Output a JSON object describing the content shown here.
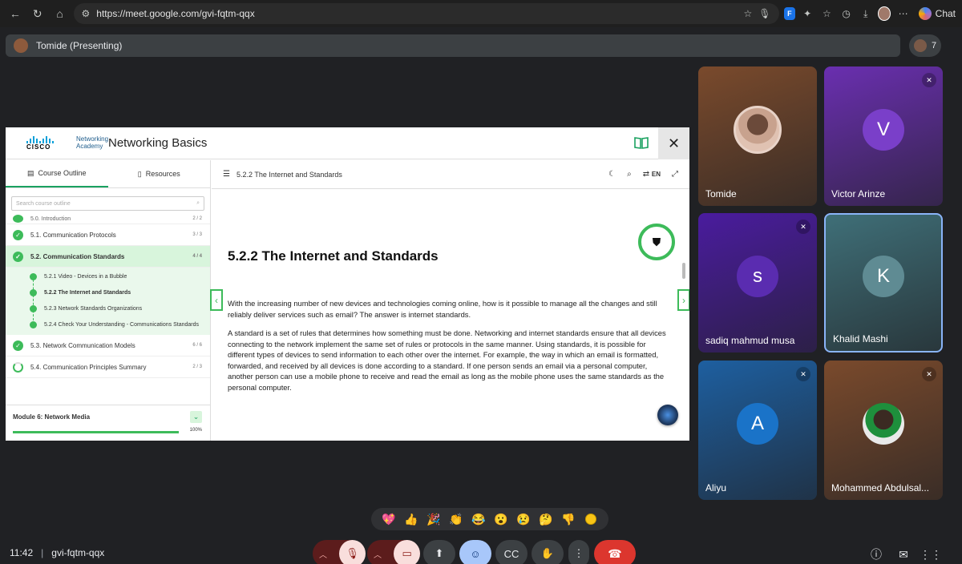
{
  "browser": {
    "url": "https://meet.google.com/gvi-fqtm-qqx",
    "chat_label": "Chat"
  },
  "presenter": {
    "label": "Tomide (Presenting)",
    "participant_count": "7"
  },
  "share": {
    "academy_label": "Networking Academy",
    "cisco_word": "CISCO",
    "course_title": "Networking Basics",
    "tabs": {
      "outline": "Course Outline",
      "resources": "Resources"
    },
    "search_placeholder": "Search course outline",
    "outline": {
      "cut_item": {
        "label": "5.0. Introduction",
        "count": "2 / 2"
      },
      "items": [
        {
          "label": "5.1. Communication Protocols",
          "count": "3 / 3"
        },
        {
          "label": "5.2. Communication Standards",
          "count": "4 / 4"
        }
      ],
      "subitems": [
        "5.2.1 Video - Devices in a Bubble",
        "5.2.2 The Internet and Standards",
        "5.2.3 Network Standards Organizations",
        "5.2.4 Check Your Understanding - Communications Standards"
      ],
      "after_items": [
        {
          "label": "5.3. Network Communication Models",
          "count": "6 / 6"
        },
        {
          "label": "5.4. Communication Principles Summary",
          "count": "2 / 3"
        }
      ]
    },
    "module": {
      "title": "Module 6: Network Media",
      "percent": "100%"
    },
    "content": {
      "breadcrumb_title": "5.2.2 The Internet and Standards",
      "lang": "EN",
      "section_title": "5.2.2 The Internet and Standards",
      "para1": "With the increasing number of new devices and technologies coming online, how is it possible to manage all the changes and still reliably deliver services such as email? The answer is internet standards.",
      "para2": "A standard is a set of rules that determines how something must be done. Networking and internet standards ensure that all devices connecting to the network implement the same set of rules or protocols in the same manner. Using standards, it is possible for different types of devices to send information to each other over the internet. For example, the way in which an email is formatted, forwarded, and received by all devices is done according to a standard. If one person sends an email via a personal computer, another person can use a mobile phone to receive and read the email as long as the mobile phone uses the same standards as the personal computer."
    }
  },
  "participants": [
    {
      "name": "Tomide",
      "initial": "",
      "bg": "#7a4a2c"
    },
    {
      "name": "Victor Arinze",
      "initial": "V",
      "bg": "#6a2fb0"
    },
    {
      "name": "sadiq mahmud musa",
      "initial": "s",
      "bg": "#4a1c9e"
    },
    {
      "name": "Khalid Mashi",
      "initial": "K",
      "bg": "#3f6f78"
    },
    {
      "name": "Aliyu",
      "initial": "A",
      "bg": "#1e5fa0"
    },
    {
      "name": "Mohammed Abdulsal...",
      "initial": "",
      "bg": "#7a4a2c"
    }
  ],
  "reactions": [
    "💖",
    "👍",
    "🎉",
    "👏",
    "😂",
    "😮",
    "😢",
    "🤔",
    "👎"
  ],
  "meeting": {
    "time": "11:42",
    "code": "gvi-fqtm-qqx"
  },
  "colors": {
    "accent_green": "#3dbb5a",
    "end_call_red": "#dc362e",
    "active_blue": "#a8c7fa"
  }
}
